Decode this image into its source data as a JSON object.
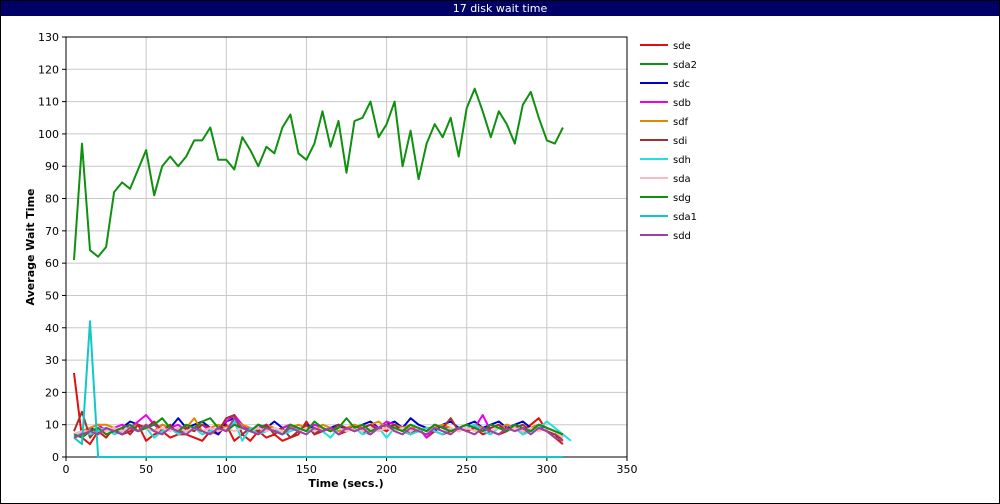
{
  "window": {
    "title": "17 disk wait time"
  },
  "chart_data": {
    "type": "line",
    "title": "17 disk wait time",
    "xlabel": "Time (secs.)",
    "ylabel": "Average Wait Time",
    "xlim": [
      0,
      350
    ],
    "ylim": [
      0,
      130
    ],
    "xticks": [
      0,
      50,
      100,
      150,
      200,
      250,
      300,
      350
    ],
    "yticks": [
      0,
      10,
      20,
      30,
      40,
      50,
      60,
      70,
      80,
      90,
      100,
      110,
      120,
      130
    ],
    "grid": true,
    "legend": "right",
    "series": [
      {
        "name": "sde",
        "color": "#e01010",
        "x": [
          5,
          10,
          15,
          20,
          25,
          30,
          35,
          40,
          45,
          50,
          55,
          60,
          65,
          70,
          75,
          80,
          85,
          90,
          95,
          100,
          105,
          110,
          115,
          120,
          125,
          130,
          135,
          140,
          145,
          150,
          155,
          160,
          165,
          170,
          175,
          180,
          185,
          190,
          195,
          200,
          205,
          210,
          215,
          220,
          225,
          230,
          235,
          240,
          245,
          250,
          255,
          260,
          265,
          270,
          275,
          280,
          285,
          290,
          295,
          300,
          305,
          310
        ],
        "y": [
          26,
          6,
          4,
          8,
          6,
          9,
          7,
          8,
          10,
          5,
          7,
          8,
          6,
          7,
          7,
          6,
          5,
          8,
          7,
          10,
          5,
          7,
          5,
          8,
          6,
          7,
          5,
          6,
          7,
          11,
          7,
          8,
          9,
          7,
          8,
          10,
          8,
          7,
          9,
          8,
          10,
          9,
          7,
          9,
          6,
          8,
          7,
          8,
          9,
          8,
          9,
          7,
          8,
          7,
          8,
          9,
          8,
          10,
          12,
          8,
          6,
          4
        ]
      },
      {
        "name": "sda2",
        "color": "#109010",
        "x": [
          5,
          10,
          15,
          20,
          25,
          30,
          35,
          40,
          45,
          50,
          55,
          60,
          65,
          70,
          75,
          80,
          85,
          90,
          95,
          100,
          105,
          110,
          115,
          120,
          125,
          130,
          135,
          140,
          145,
          150,
          155,
          160,
          165,
          170,
          175,
          180,
          185,
          190,
          195,
          200,
          205,
          210,
          215,
          220,
          225,
          230,
          235,
          240,
          245,
          250,
          255,
          260,
          265,
          270,
          275,
          280,
          285,
          290,
          295,
          300,
          305,
          310
        ],
        "y": [
          61,
          97,
          64,
          62,
          65,
          82,
          85,
          83,
          89,
          95,
          81,
          90,
          93,
          90,
          93,
          98,
          98,
          102,
          92,
          92,
          89,
          99,
          95,
          90,
          96,
          94,
          102,
          106,
          94,
          92,
          97,
          107,
          96,
          104,
          88,
          104,
          105,
          110,
          99,
          103,
          110,
          90,
          101,
          86,
          97,
          103,
          99,
          105,
          93,
          108,
          114,
          107,
          99,
          107,
          103,
          97,
          109,
          113,
          105,
          98,
          97,
          102
        ]
      },
      {
        "name": "sdc",
        "color": "#0000cc",
        "x": [
          5,
          10,
          15,
          20,
          25,
          30,
          35,
          40,
          45,
          50,
          55,
          60,
          65,
          70,
          75,
          80,
          85,
          90,
          95,
          100,
          105,
          110,
          115,
          120,
          125,
          130,
          135,
          140,
          145,
          150,
          155,
          160,
          165,
          170,
          175,
          180,
          185,
          190,
          195,
          200,
          205,
          210,
          215,
          220,
          225,
          230,
          235,
          240,
          245,
          250,
          255,
          260,
          265,
          270,
          275,
          280,
          285,
          290,
          295,
          300,
          305,
          310
        ],
        "y": [
          6,
          7,
          9,
          8,
          9,
          8,
          9,
          11,
          10,
          9,
          8,
          10,
          9,
          12,
          9,
          10,
          11,
          9,
          7,
          11,
          12,
          10,
          8,
          10,
          9,
          11,
          9,
          10,
          8,
          10,
          9,
          8,
          9,
          10,
          8,
          9,
          10,
          11,
          9,
          10,
          11,
          9,
          12,
          10,
          9,
          8,
          10,
          11,
          9,
          10,
          11,
          9,
          10,
          11,
          9,
          10,
          11,
          9,
          10,
          9,
          8,
          6
        ]
      },
      {
        "name": "sdb",
        "color": "#ee00ee",
        "x": [
          5,
          10,
          15,
          20,
          25,
          30,
          35,
          40,
          45,
          50,
          55,
          60,
          65,
          70,
          75,
          80,
          85,
          90,
          95,
          100,
          105,
          110,
          115,
          120,
          125,
          130,
          135,
          140,
          145,
          150,
          155,
          160,
          165,
          170,
          175,
          180,
          185,
          190,
          195,
          200,
          205,
          210,
          215,
          220,
          225,
          230,
          235,
          240,
          245,
          250,
          255,
          260,
          265,
          270,
          275,
          280,
          285,
          290,
          295,
          300,
          305,
          310
        ],
        "y": [
          7,
          8,
          9,
          10,
          8,
          9,
          10,
          9,
          11,
          13,
          10,
          8,
          9,
          10,
          8,
          9,
          10,
          8,
          9,
          11,
          13,
          10,
          8,
          9,
          10,
          8,
          9,
          10,
          8,
          9,
          10,
          9,
          8,
          10,
          9,
          8,
          9,
          10,
          9,
          11,
          10,
          9,
          8,
          9,
          6,
          9,
          10,
          8,
          9,
          10,
          9,
          13,
          8,
          9,
          10,
          9,
          8,
          9,
          10,
          8,
          6,
          7
        ]
      },
      {
        "name": "sdf",
        "color": "#e08800",
        "x": [
          5,
          10,
          15,
          20,
          25,
          30,
          35,
          40,
          45,
          50,
          55,
          60,
          65,
          70,
          75,
          80,
          85,
          90,
          95,
          100,
          105,
          110,
          115,
          120,
          125,
          130,
          135,
          140,
          145,
          150,
          155,
          160,
          165,
          170,
          175,
          180,
          185,
          190,
          195,
          200,
          205,
          210,
          215,
          220,
          225,
          230,
          235,
          240,
          245,
          250,
          255,
          260,
          265,
          270,
          275,
          280,
          285,
          290,
          295,
          300,
          305,
          310
        ],
        "y": [
          7,
          8,
          9,
          10,
          10,
          9,
          8,
          9,
          10,
          9,
          8,
          10,
          9,
          8,
          9,
          12,
          8,
          9,
          10,
          9,
          11,
          10,
          9,
          8,
          10,
          9,
          8,
          9,
          10,
          9,
          8,
          10,
          9,
          8,
          9,
          10,
          9,
          10,
          11,
          9,
          10,
          9,
          10,
          8,
          9,
          9,
          10,
          9,
          8,
          9,
          10,
          9,
          8,
          9,
          10,
          9,
          7,
          9,
          10,
          9,
          8,
          5
        ]
      },
      {
        "name": "sdi",
        "color": "#a03030",
        "x": [
          5,
          10,
          15,
          20,
          25,
          30,
          35,
          40,
          45,
          50,
          55,
          60,
          65,
          70,
          75,
          80,
          85,
          90,
          95,
          100,
          105,
          110,
          115,
          120,
          125,
          130,
          135,
          140,
          145,
          150,
          155,
          160,
          165,
          170,
          175,
          180,
          185,
          190,
          195,
          200,
          205,
          210,
          215,
          220,
          225,
          230,
          235,
          240,
          245,
          250,
          255,
          260,
          265,
          270,
          275,
          280,
          285,
          290,
          295,
          300,
          305,
          310
        ],
        "y": [
          8,
          14,
          6,
          9,
          7,
          8,
          9,
          7,
          10,
          9,
          11,
          8,
          10,
          7,
          9,
          8,
          10,
          9,
          8,
          12,
          13,
          7,
          9,
          8,
          10,
          7,
          9,
          6,
          8,
          10,
          7,
          9,
          8,
          10,
          9,
          8,
          9,
          10,
          8,
          9,
          10,
          8,
          7,
          9,
          8,
          10,
          9,
          12,
          8,
          9,
          10,
          8,
          9,
          10,
          8,
          9,
          10,
          8,
          9,
          8,
          7,
          5
        ]
      },
      {
        "name": "sdh",
        "color": "#20e0e0",
        "x": [
          5,
          10,
          15,
          20,
          25,
          30,
          35,
          40,
          45,
          50,
          55,
          60,
          65,
          70,
          75,
          80,
          85,
          90,
          95,
          100,
          105,
          110,
          115,
          120,
          125,
          130,
          135,
          140,
          145,
          150,
          155,
          160,
          165,
          170,
          175,
          180,
          185,
          190,
          195,
          200,
          205,
          210,
          215,
          220,
          225,
          230,
          235,
          240,
          245,
          250,
          255,
          260,
          265,
          270,
          275,
          280,
          285,
          290,
          295,
          300,
          305,
          310,
          315
        ],
        "y": [
          6,
          8,
          7,
          8,
          9,
          7,
          8,
          9,
          8,
          9,
          6,
          8,
          9,
          7,
          8,
          9,
          7,
          8,
          9,
          8,
          11,
          5,
          9,
          7,
          8,
          9,
          7,
          8,
          9,
          8,
          9,
          8,
          6,
          9,
          8,
          9,
          7,
          8,
          9,
          6,
          9,
          8,
          7,
          8,
          9,
          8,
          7,
          9,
          8,
          9,
          10,
          8,
          7,
          9,
          8,
          9,
          7,
          8,
          9,
          11,
          9,
          7,
          5
        ]
      },
      {
        "name": "sda",
        "color": "#ffb8c0",
        "x": [
          5,
          10,
          15,
          20,
          25,
          30,
          35,
          40,
          45,
          50,
          55,
          60,
          65,
          70,
          75,
          80,
          85,
          90,
          95,
          100,
          105,
          110,
          115,
          120,
          125,
          130,
          135,
          140,
          145,
          150,
          155,
          160,
          165,
          170,
          175,
          180,
          185,
          190,
          195,
          200,
          205,
          210,
          215,
          220,
          225,
          230,
          235,
          240,
          245,
          250,
          255,
          260,
          265,
          270,
          275,
          280,
          285,
          290,
          295,
          300,
          305,
          310
        ],
        "y": [
          7,
          8,
          8,
          9,
          8,
          9,
          8,
          9,
          8,
          9,
          8,
          9,
          8,
          9,
          8,
          9,
          8,
          9,
          8,
          9,
          8,
          9,
          8,
          9,
          8,
          9,
          8,
          9,
          8,
          9,
          8,
          9,
          8,
          9,
          8,
          9,
          8,
          9,
          8,
          9,
          8,
          9,
          8,
          9,
          8,
          9,
          8,
          9,
          8,
          9,
          8,
          9,
          8,
          9,
          8,
          9,
          8,
          9,
          8,
          9,
          8,
          6
        ]
      },
      {
        "name": "sdg",
        "color": "#109010",
        "x": [
          5,
          10,
          15,
          20,
          25,
          30,
          35,
          40,
          45,
          50,
          55,
          60,
          65,
          70,
          75,
          80,
          85,
          90,
          95,
          100,
          105,
          110,
          115,
          120,
          125,
          130,
          135,
          140,
          145,
          150,
          155,
          160,
          165,
          170,
          175,
          180,
          185,
          190,
          195,
          200,
          205,
          210,
          215,
          220,
          225,
          230,
          235,
          240,
          245,
          250,
          255,
          260,
          265,
          270,
          275,
          280,
          285,
          290,
          295,
          300,
          305,
          310
        ],
        "y": [
          7,
          6,
          8,
          9,
          7,
          8,
          9,
          10,
          8,
          9,
          10,
          12,
          9,
          8,
          10,
          9,
          11,
          12,
          9,
          8,
          10,
          9,
          8,
          10,
          9,
          8,
          7,
          10,
          9,
          8,
          11,
          9,
          8,
          9,
          12,
          9,
          10,
          8,
          9,
          10,
          9,
          8,
          10,
          9,
          8,
          10,
          9,
          8,
          9,
          10,
          9,
          8,
          10,
          9,
          8,
          10,
          9,
          8,
          10,
          9,
          8,
          7
        ]
      },
      {
        "name": "sda1",
        "color": "#10c8c8",
        "x": [
          5,
          10,
          15,
          20,
          25,
          310
        ],
        "y": [
          6,
          4,
          42,
          0,
          0,
          0
        ]
      },
      {
        "name": "sdd",
        "color": "#a040a0",
        "x": [
          5,
          10,
          15,
          20,
          25,
          30,
          35,
          40,
          45,
          50,
          55,
          60,
          65,
          70,
          75,
          80,
          85,
          90,
          95,
          100,
          105,
          110,
          115,
          120,
          125,
          130,
          135,
          140,
          145,
          150,
          155,
          160,
          165,
          170,
          175,
          180,
          185,
          190,
          195,
          200,
          205,
          210,
          215,
          220,
          225,
          230,
          235,
          240,
          245,
          250,
          255,
          260,
          265,
          270,
          275,
          280,
          285,
          290,
          295,
          300,
          305,
          310
        ],
        "y": [
          6,
          7,
          8,
          7,
          9,
          8,
          7,
          9,
          8,
          10,
          8,
          7,
          9,
          8,
          7,
          9,
          8,
          7,
          9,
          8,
          12,
          9,
          8,
          7,
          9,
          8,
          7,
          9,
          8,
          7,
          9,
          8,
          9,
          7,
          9,
          8,
          9,
          7,
          9,
          10,
          8,
          7,
          9,
          8,
          7,
          9,
          8,
          7,
          9,
          8,
          7,
          9,
          8,
          7,
          9,
          8,
          9,
          7,
          9,
          8,
          6,
          5
        ]
      }
    ]
  }
}
